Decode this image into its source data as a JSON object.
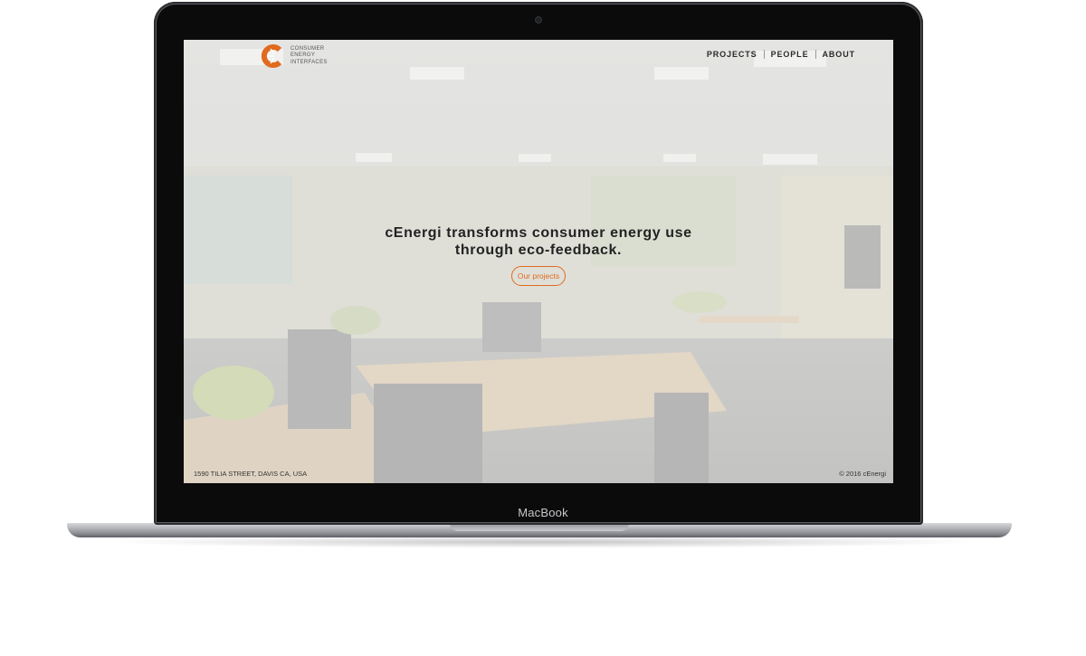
{
  "device": {
    "brand_label": "MacBook"
  },
  "site": {
    "logo": {
      "lines": [
        "CONSUMER",
        "ENERGY",
        "INTERFACES"
      ],
      "accent_color": "#e06a1e"
    },
    "nav": [
      {
        "label": "PROJECTS"
      },
      {
        "label": "PEOPLE"
      },
      {
        "label": "ABOUT"
      }
    ],
    "hero": {
      "headline": "cEnergi transforms consumer energy use through eco-feedback.",
      "cta_label": "Our projects"
    },
    "footer": {
      "address": "1590 TILIA STREET, DAVIS CA, USA",
      "copyright": "© 2016 cEnergi"
    }
  }
}
